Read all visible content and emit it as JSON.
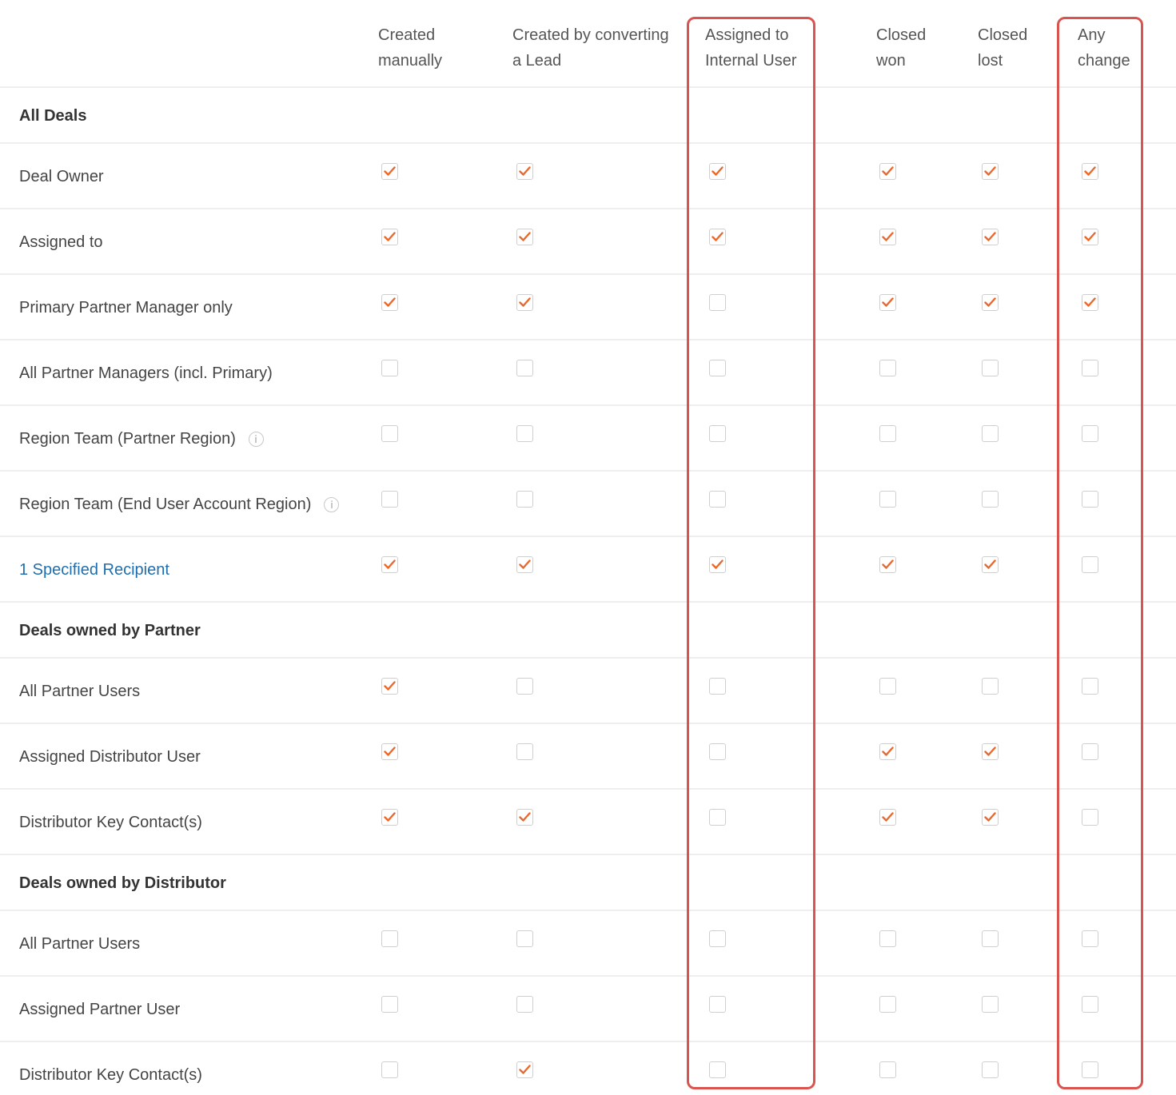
{
  "columns": [
    {
      "line1": "Created",
      "line2": "manually"
    },
    {
      "line1": "Created by converting",
      "line2": "a Lead"
    },
    {
      "line1": "Assigned to",
      "line2": "Internal User"
    },
    {
      "line1": "Closed",
      "line2": "won"
    },
    {
      "line1": "Closed",
      "line2": "lost"
    },
    {
      "line1": "Any",
      "line2": "change"
    }
  ],
  "rows": [
    {
      "type": "section",
      "label": "All Deals"
    },
    {
      "type": "row",
      "label": "Deal Owner",
      "checks": [
        true,
        true,
        true,
        true,
        true,
        true
      ]
    },
    {
      "type": "row",
      "label": "Assigned to",
      "checks": [
        true,
        true,
        true,
        true,
        true,
        true
      ]
    },
    {
      "type": "row",
      "label": "Primary Partner Manager only",
      "checks": [
        true,
        true,
        false,
        true,
        true,
        true
      ]
    },
    {
      "type": "row",
      "label": "All Partner Managers (incl. Primary)",
      "checks": [
        false,
        false,
        false,
        false,
        false,
        false
      ]
    },
    {
      "type": "row",
      "label": "Region Team (Partner Region)",
      "info": true,
      "checks": [
        false,
        false,
        false,
        false,
        false,
        false
      ]
    },
    {
      "type": "row",
      "label": "Region Team (End User Account Region)",
      "info": true,
      "checks": [
        false,
        false,
        false,
        false,
        false,
        false
      ]
    },
    {
      "type": "row",
      "label": "1 Specified Recipient",
      "link": true,
      "checks": [
        true,
        true,
        true,
        true,
        true,
        false
      ]
    },
    {
      "type": "section",
      "label": "Deals owned by Partner"
    },
    {
      "type": "row",
      "label": "All Partner Users",
      "checks": [
        true,
        false,
        false,
        false,
        false,
        false
      ]
    },
    {
      "type": "row",
      "label": "Assigned Distributor User",
      "checks": [
        true,
        false,
        false,
        true,
        true,
        false
      ]
    },
    {
      "type": "row",
      "label": "Distributor Key Contact(s)",
      "checks": [
        true,
        true,
        false,
        true,
        true,
        false
      ]
    },
    {
      "type": "section",
      "label": "Deals owned by Distributor"
    },
    {
      "type": "row",
      "label": "All Partner Users",
      "checks": [
        false,
        false,
        false,
        false,
        false,
        false
      ]
    },
    {
      "type": "row",
      "label": "Assigned Partner User",
      "checks": [
        false,
        false,
        false,
        false,
        false,
        false
      ]
    },
    {
      "type": "row",
      "label": "Distributor Key Contact(s)",
      "checks": [
        false,
        true,
        false,
        false,
        false,
        false
      ]
    }
  ],
  "colors": {
    "check": "#e8692d",
    "highlight": "#d9534f",
    "link": "#1f6fb0"
  },
  "icons": {
    "checkbox_checked": "checkmark-icon",
    "info": "info-circle-icon"
  }
}
